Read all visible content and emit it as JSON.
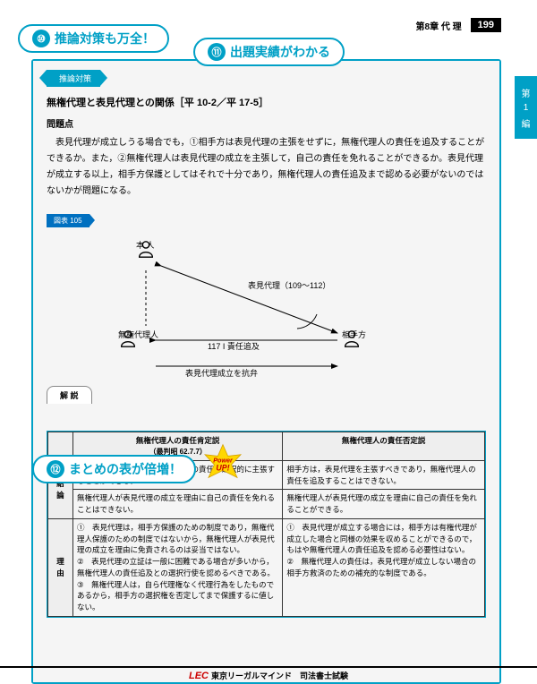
{
  "header": {
    "chapter": "第8章 代 理",
    "page": "199"
  },
  "sidetab": {
    "l1": "第",
    "l2": "1",
    "l3": "編"
  },
  "callouts": {
    "c10_num": "⑩",
    "c10": "推論対策も万全！",
    "c11_num": "⑪",
    "c11": "出題実績がわかる",
    "c12_num": "⑫",
    "c12": "まとめの表が倍増！"
  },
  "powerup": {
    "l1": "Power",
    "l2": "UP!"
  },
  "badges": {
    "suiron": "推論対策",
    "chart": "図表 105",
    "explain": "解 説"
  },
  "title": "無権代理と表見代理との関係［平 10-2／平 17-5］",
  "sections": {
    "problem": "問題点"
  },
  "problem_text": "表見代理が成立しうる場合でも，①相手方は表見代理の主張をせずに，無権代理人の責任を追及することができるか。また，②無権代理人は表見代理の成立を主張して，自己の責任を免れることができるか。表見代理が成立する以上，相手方保護としてはそれで十分であり，無権代理人の責任追及まで認める必要がないのではないかが問題になる。",
  "diagram": {
    "top": "本 人",
    "left": "無権代理人",
    "right": "相手方",
    "apparent": "表見代理（109～112）",
    "liability": "117 I 責任追及",
    "defense": "表見代理成立を抗弁"
  },
  "table": {
    "col1": "無権代理人の責任肯定説",
    "col1_sub": "（最判昭 62.7.7）",
    "col2": "無権代理人の責任否定説",
    "row1": "結 論",
    "row2": "理 由",
    "r1c1a": "相手方は，表見代理と無権代理人の責任を選択的に主張することができる。",
    "r1c1b": "無権代理人が表見代理の成立を理由に自己の責任を免れることはできない。",
    "r1c2a": "相手方は，表見代理を主張すべきであり，無権代理人の責任を追及することはできない。",
    "r1c2b": "無権代理人が表見代理の成立を理由に自己の責任を免れることができる。",
    "r2c1": "①　表見代理は，相手方保護のための制度であり，無権代理人保護のための制度ではないから，無権代理人が表見代理の成立を理由に免責されるのは妥当ではない。\n②　表見代理の立証は一般に困難である場合が多いから，無権代理人の責任追及との選択行使を認めるべきである。\n③　無権代理人は，自ら代理権なく代理行為をしたものであるから，相手方の選択権を否定してまで保護するに値しない。",
    "r2c2": "①　表見代理が成立する場合には，相手方は有権代理が成立した場合と同様の効果を収めることができるので，もはや無権代理人の責任追及を認める必要性はない。\n②　無権代理人の責任は，表見代理が成立しない場合の相手方救済のための補充的な制度である。"
  },
  "footer": {
    "brand": "LEC",
    "company": "東京リーガルマインド",
    "exam": "司法書士試験"
  }
}
